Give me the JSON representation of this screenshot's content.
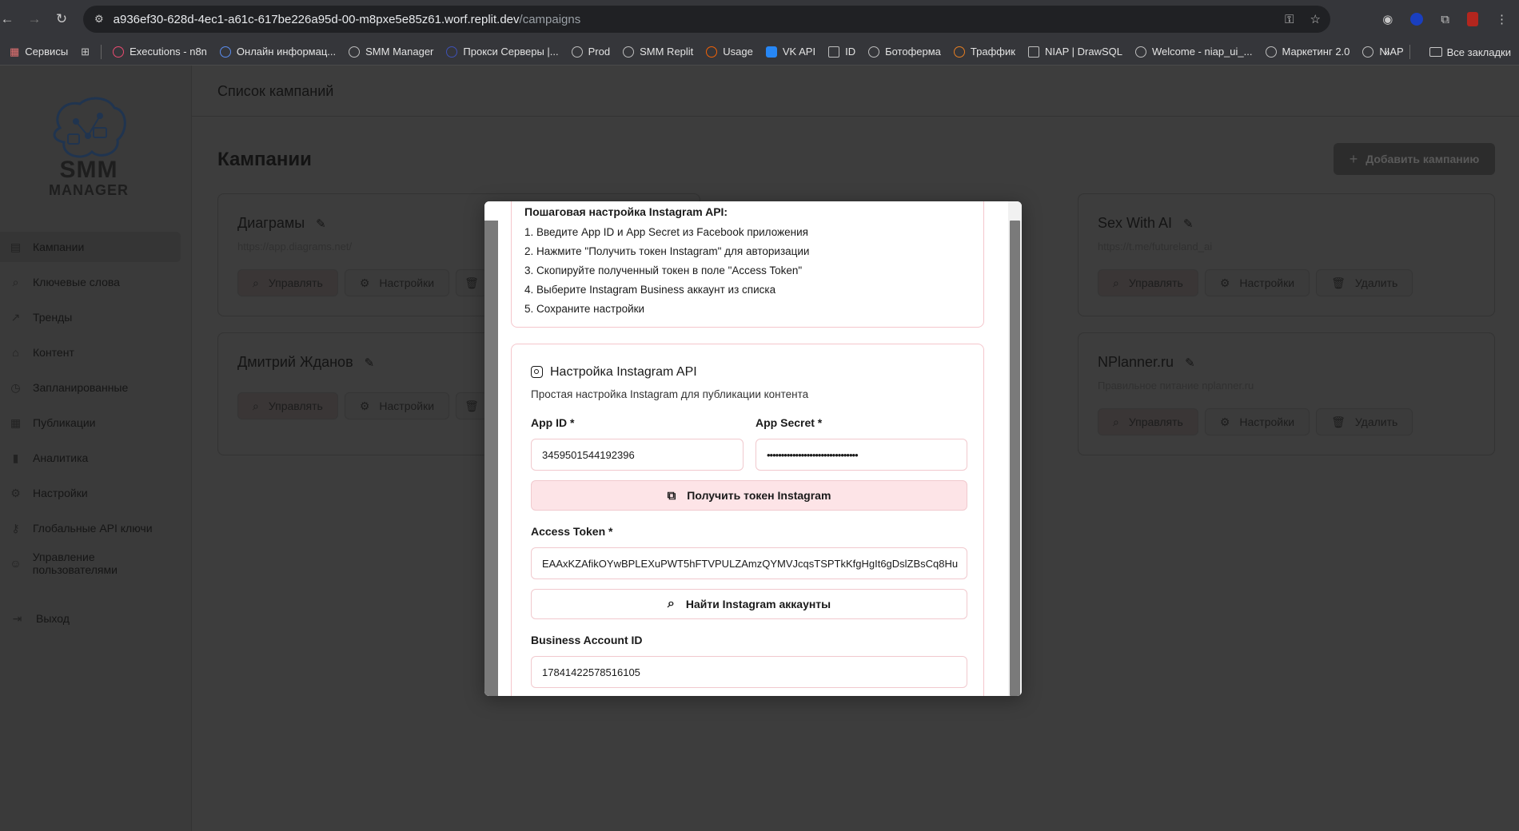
{
  "browser": {
    "url_main": "a936ef30-628d-4ec1-a61c-617be226a95d-00-m8pxe5e85z61.worf.replit.dev",
    "url_path": "/campaigns",
    "bookmarks": [
      "Сервисы",
      "Executions - n8n",
      "Онлайн информац...",
      "SMM Manager",
      "Прокси Серверы |...",
      "Prod",
      "SMM Replit",
      "Usage",
      "VK API",
      "ID",
      "Ботоферма",
      "Траффик",
      "NIAP | DrawSQL",
      "Welcome - niap_ui_...",
      "Маркетинг 2.0",
      "NIAP"
    ],
    "all_bookmarks": "Все закладки",
    "more": "»"
  },
  "logo": {
    "line1": "SMM",
    "line2": "MANAGER"
  },
  "sidebar": {
    "items": [
      {
        "label": "Кампании",
        "icon": "file-icon"
      },
      {
        "label": "Ключевые слова",
        "icon": "search-icon"
      },
      {
        "label": "Тренды",
        "icon": "trend-icon"
      },
      {
        "label": "Контент",
        "icon": "tag-icon"
      },
      {
        "label": "Запланированные",
        "icon": "clock-icon"
      },
      {
        "label": "Публикации",
        "icon": "calendar-icon"
      },
      {
        "label": "Аналитика",
        "icon": "bar-chart-icon"
      },
      {
        "label": "Настройки",
        "icon": "gear-icon"
      },
      {
        "label": "Глобальные API ключи",
        "icon": "key-icon"
      },
      {
        "label": "Управление пользователями",
        "icon": "users-icon"
      }
    ],
    "logout": "Выход"
  },
  "header": {
    "title": "Список кампаний"
  },
  "main": {
    "heading": "Кампании",
    "add_button": "Добавить кампанию",
    "cards": [
      {
        "title": "Диаграмы",
        "sub": "https://app.diagrams.net/",
        "manage": "Управлять",
        "settings": "Настройки",
        "delete": ""
      },
      {
        "title": "Sex With AI",
        "sub": "https://t.me/futureland_ai",
        "manage": "Управлять",
        "settings": "Настройки",
        "delete": "Удалить"
      },
      {
        "title": "Дмитрий Жданов",
        "sub": "",
        "manage": "Управлять",
        "settings": "Настройки",
        "delete": ""
      },
      {
        "title": "NPlanner.ru",
        "sub": "Правильное питание nplanner.ru",
        "manage": "Управлять",
        "settings": "Настройки",
        "delete": "Удалить"
      }
    ]
  },
  "modal": {
    "steps_title": "Пошаговая настройка Instagram API:",
    "steps": [
      "1. Введите App ID и App Secret из Facebook приложения",
      "2. Нажмите \"Получить токен Instagram\" для авторизации",
      "3. Скопируйте полученный токен в поле \"Access Token\"",
      "4. Выберите Instagram Business аккаунт из списка",
      "5. Сохраните настройки"
    ],
    "section_title": "Настройка Instagram API",
    "section_desc": "Простая настройка Instagram для публикации контента",
    "app_id_label": "App ID *",
    "app_id_value": "3459501544192396",
    "app_secret_label": "App Secret *",
    "app_secret_value": "••••••••••••••••••••••••••••••••",
    "get_token_button": "Получить токен Instagram",
    "access_token_label": "Access Token *",
    "access_token_value": "EAAxKZAfikOYwBPLEXuPWT5hFTVPULZAmzQYMVJcqsTSPTkKfgHgIt6gDslZBsCq8Hu",
    "find_accounts_button": "Найти Instagram аккаунты",
    "business_id_label": "Business Account ID",
    "business_id_value": "17841422578516105"
  },
  "colors": {
    "accent_pink": "#fde4e7",
    "border_pink": "#f1c9ce",
    "overlay": "#3d3d3d"
  }
}
